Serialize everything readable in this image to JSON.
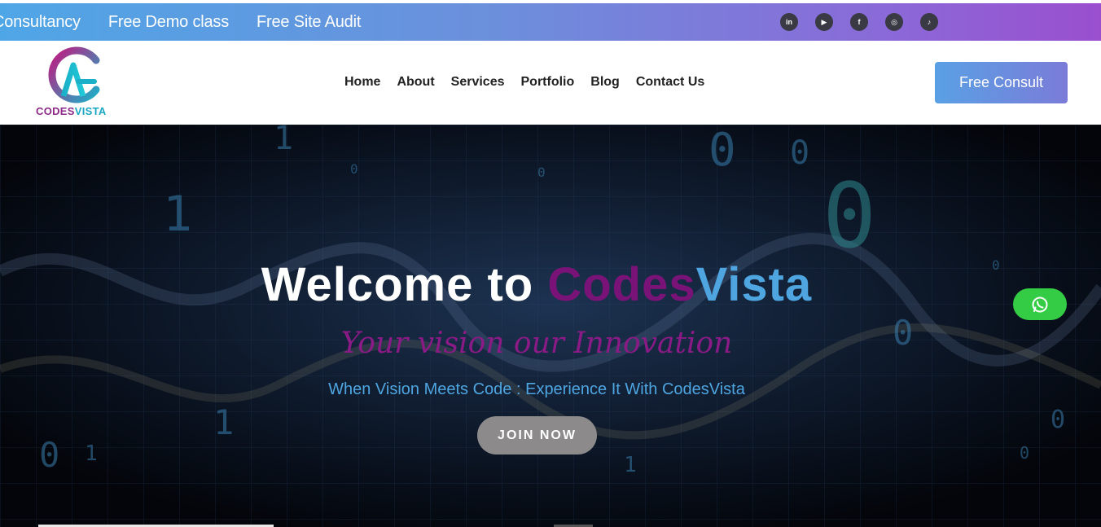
{
  "topbar": {
    "ticker": [
      "Consultancy",
      "Free Demo class",
      "Free Site Audit"
    ],
    "socials": [
      {
        "icon": "linkedin-icon",
        "glyph": "in"
      },
      {
        "icon": "youtube-icon",
        "glyph": "▶"
      },
      {
        "icon": "facebook-icon",
        "glyph": "f"
      },
      {
        "icon": "instagram-icon",
        "glyph": "◎"
      },
      {
        "icon": "tiktok-icon",
        "glyph": "♪"
      }
    ]
  },
  "header": {
    "logo": {
      "part1": "CODES",
      "part2": "VISTA"
    },
    "nav": [
      "Home",
      "About",
      "Services",
      "Portfolio",
      "Blog",
      "Contact Us"
    ],
    "cta": "Free Consult"
  },
  "hero": {
    "title_white": "Welcome to ",
    "title_purple": "Codes",
    "title_blue": "Vista",
    "tagline": "Your vision our Innovation",
    "subline": "When Vision Meets Code : Experience It With CodesVista",
    "button": "JOIN NOW",
    "whatsapp_icon": "whatsapp-icon"
  },
  "colors": {
    "brand_purple": "#7a1378",
    "brand_blue": "#4ea5e0",
    "whatsapp_green": "#33cc44"
  }
}
